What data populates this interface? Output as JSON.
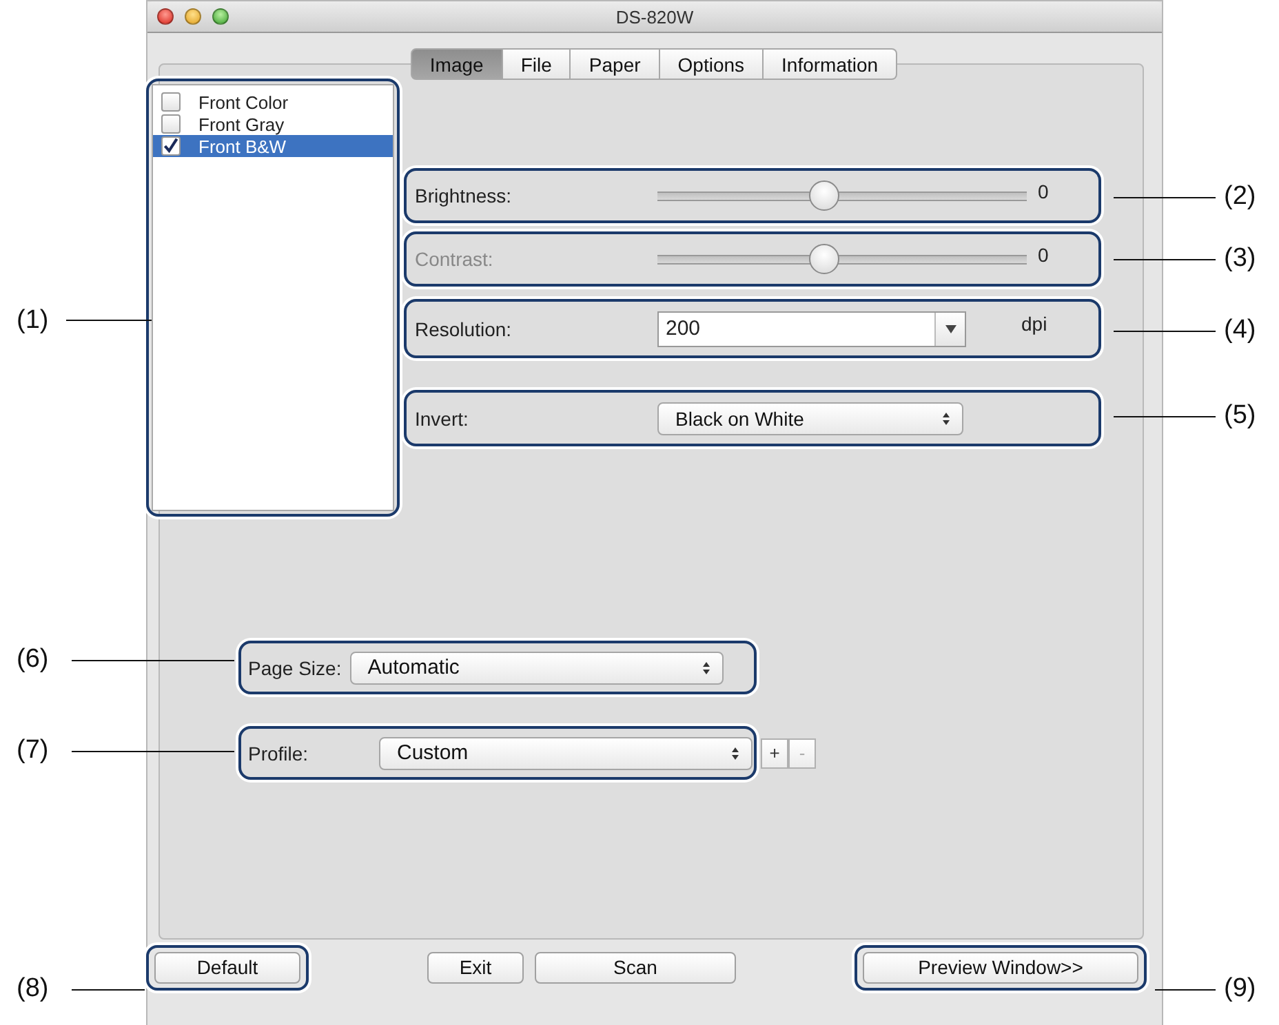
{
  "window": {
    "title": "DS-820W"
  },
  "tabs": [
    {
      "label": "Image",
      "selected": true
    },
    {
      "label": "File",
      "selected": false
    },
    {
      "label": "Paper",
      "selected": false
    },
    {
      "label": "Options",
      "selected": false
    },
    {
      "label": "Information",
      "selected": false
    }
  ],
  "image_modes": [
    {
      "label": "Front Color",
      "checked": false,
      "selected": false
    },
    {
      "label": "Front Gray",
      "checked": false,
      "selected": false
    },
    {
      "label": "Front B&W",
      "checked": true,
      "selected": true
    }
  ],
  "settings": [
    {
      "kind": "slider",
      "label": "Brightness:",
      "level": 0.45,
      "reading": "0",
      "disabled": false
    },
    {
      "kind": "slider",
      "label": "Contrast:",
      "level": 0.45,
      "reading": "0",
      "disabled": true
    },
    {
      "kind": "combo",
      "label": "Resolution:",
      "value": "200",
      "unit": "dpi"
    },
    {
      "kind": "popup",
      "label": "Invert:",
      "value": "Black on White"
    }
  ],
  "page_size": {
    "label": "Page Size:",
    "value": "Automatic"
  },
  "profile": {
    "label": "Profile:",
    "value": "Custom",
    "add": "+",
    "remove": "-",
    "remove_disabled": true
  },
  "buttons": [
    {
      "label": "Default"
    },
    {
      "label": "Exit"
    },
    {
      "label": "Scan"
    },
    {
      "label": "Preview Window>>"
    }
  ],
  "callouts": [
    {
      "label": "(2)"
    },
    {
      "label": "(3)"
    },
    {
      "label": "(1)"
    },
    {
      "label": "(4)"
    },
    {
      "label": "(5)"
    },
    {
      "label": "(6)"
    },
    {
      "label": "(7)"
    },
    {
      "label": "(8)"
    },
    {
      "label": "(9)"
    }
  ]
}
